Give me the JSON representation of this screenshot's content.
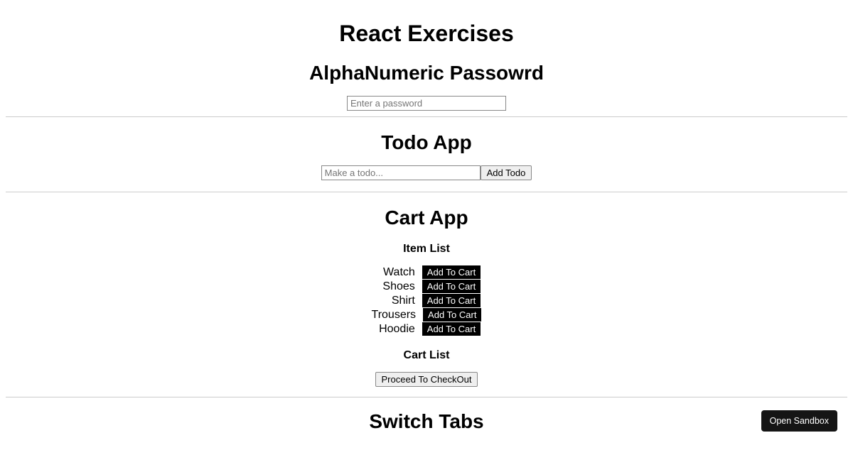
{
  "page": {
    "title": "React Exercises"
  },
  "password": {
    "heading": "AlphaNumeric Passowrd",
    "placeholder": "Enter a password"
  },
  "todo": {
    "heading": "Todo App",
    "placeholder": "Make a todo...",
    "add_button": "Add Todo"
  },
  "cart": {
    "heading": "Cart App",
    "item_list_heading": "Item List",
    "cart_list_heading": "Cart List",
    "checkout_button": "Proceed To CheckOut",
    "add_button": "Add To Cart",
    "items": [
      {
        "name": "Watch"
      },
      {
        "name": "Shoes"
      },
      {
        "name": "Shirt"
      },
      {
        "name": "Trousers"
      },
      {
        "name": "Hoodie"
      }
    ]
  },
  "tabs": {
    "heading": "Switch Tabs"
  },
  "sandbox": {
    "button": "Open Sandbox"
  }
}
